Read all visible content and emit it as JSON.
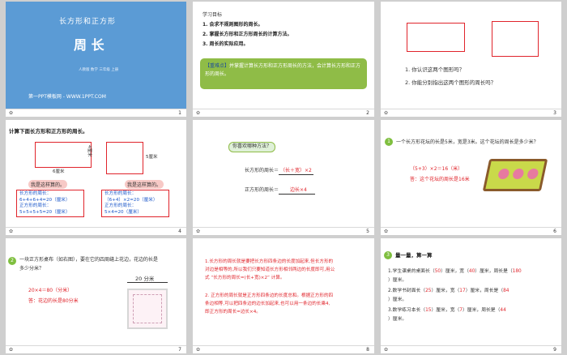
{
  "footer": {
    "icon": "✿"
  },
  "slide1": {
    "subtitle": "长方形和正方形",
    "title": "周 长",
    "publisher": "人教版 数学 三年级 上册",
    "watermark": "第一PPT模板网 - WWW.1PPT.COM",
    "number": "1",
    "bg": "#5b9bd5"
  },
  "slide2": {
    "heading": "学习目标",
    "goals": [
      "1. 会求不规则图形的周长。",
      "2. 掌握长方形和正方形周长的计算方法。",
      "3. 周长的实际应用。"
    ],
    "key_label": "【重难点】",
    "key_text": "并掌握计算长方形和正方形周长的方法，会计算长方形和正方形的周长。",
    "number": "2",
    "box_color": "#8fbc47"
  },
  "slide3": {
    "q1": "1. 你认识这两个图形吗？",
    "q2": "2. 你能分别指出这两个图形的周长吗？",
    "number": "3"
  },
  "slide4": {
    "heading": "计算下面长方形和正方形的周长。",
    "label_4": "4厘米",
    "label_6": "6厘米",
    "label_5": "5厘米",
    "bubble_left": "我是这样算的。",
    "bubble_right": "我是这样算的。",
    "left_box": [
      "长方形的周长：",
      "6+4+6+4=20（厘米）",
      "正方形的周长：",
      "5+5+5+5=20（厘米）"
    ],
    "right_box": [
      "长方形的周长：",
      "（6+4）×2=20（厘米）",
      "正方形的周长：",
      "5×4=20（厘米）"
    ],
    "number": "4"
  },
  "slide5": {
    "question": "你喜欢哪种方法？",
    "rect_label": "长方形的周长＝",
    "rect_formula": "（长＋宽）×2",
    "square_label": "正方形的周长＝",
    "square_formula": "边长×4",
    "number": "5"
  },
  "slide6": {
    "badge": "1",
    "problem": "一个长方形花坛的长是5米，宽是3米。这个花坛的周长是多少米？",
    "calc": "（5+3）×2＝16（米）",
    "answer": "答：这个花坛的周长是16米",
    "number": "6"
  },
  "slide7": {
    "badge": "2",
    "problem": [
      "一块正方形桌布（如右图），要在它的四周缝上花边，花边的长是",
      "多少分米？"
    ],
    "calc": "20×4＝80（分米）",
    "answer": "答：花边的长是80分米",
    "dim_label": "20 分米",
    "number": "7"
  },
  "slide8": {
    "p1": [
      "1.长方形的周长就是要把长方形四条边的长度加起来,但长方形的",
      "对边是相等的,所以我们只要知道长方形相邻两边的长度即可,用公",
      "式 “长方形的周长=(长+宽)×2” 计算。"
    ],
    "p2": [
      "2. 正方形的周长就是正方形四条边的长度总和。根据正方形的四",
      "条边相等,可以把四条边的边长加起来,也可以用一条边的长乘4,",
      "即正方形的周长=边长×4。"
    ],
    "number": "8"
  },
  "slide9": {
    "badge": "3",
    "heading": "量一量，算一算",
    "items": [
      {
        "pre": "1.学生课桌的桌面长（",
        "a": "50",
        "mid": "）厘米，宽（",
        "b": "40",
        "post": "）厘米，周长是（",
        "c": "180",
        "end": "）厘米。"
      },
      {
        "pre": "2.数学书封面长（",
        "a": "25",
        "mid": "）厘米，宽（",
        "b": "17",
        "post": "）厘米，周长是（",
        "c": "84",
        "end": "）厘米。"
      },
      {
        "pre": "3.数学练习本长（",
        "a": "15",
        "mid": "）厘米，宽（",
        "b": "7",
        "post": "）厘米，周长是（",
        "c": "44",
        "end": "）厘米。"
      }
    ],
    "number": "9"
  }
}
